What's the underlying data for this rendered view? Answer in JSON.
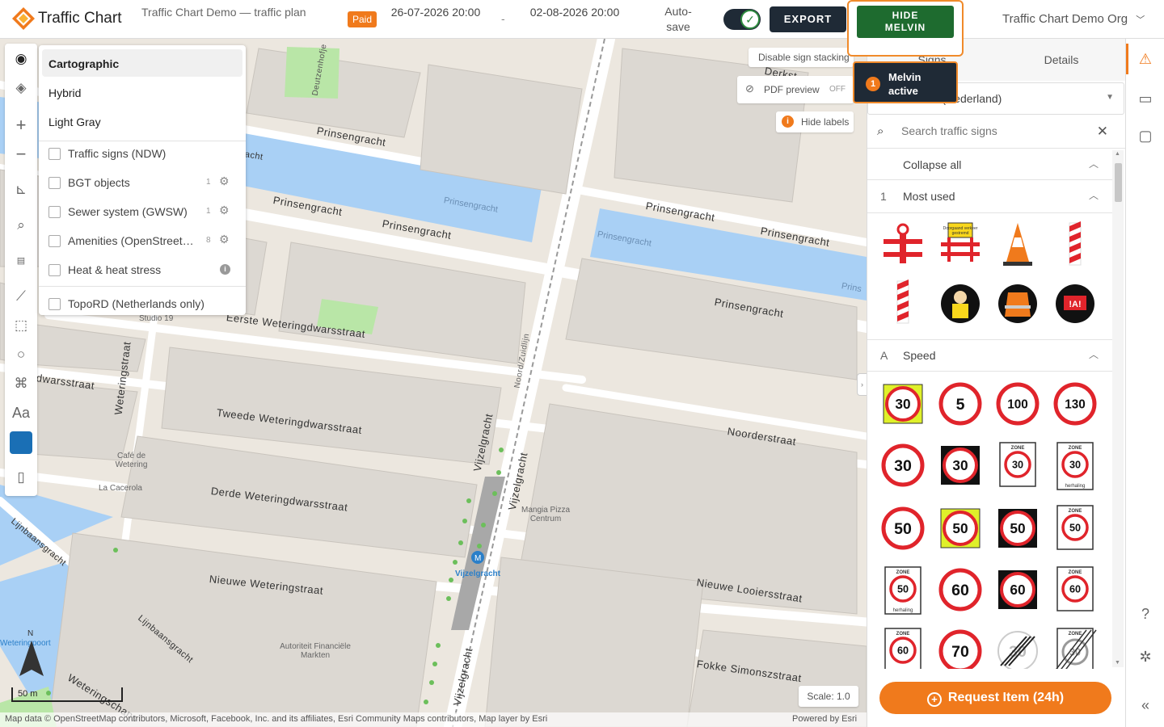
{
  "app": {
    "name": "Traffic Chart",
    "doc_title": "Traffic Chart Demo — traffic plan",
    "status_badge": "Paid"
  },
  "dates": {
    "start": "26-07-2026 20:00",
    "separator": "-",
    "end": "02-08-2026 20:00"
  },
  "autosave": {
    "label": "Auto-save",
    "on": true
  },
  "buttons": {
    "export": "EXPORT",
    "hide_melvin": "HIDE MELVIN",
    "request": "Request Item (24h)"
  },
  "org": {
    "name": "Traffic Chart Demo Org"
  },
  "colors": {
    "accent": "#f07a1c",
    "dark": "#1f2a36",
    "green": "#1e6b2f"
  },
  "basemaps": {
    "items": [
      "Cartographic",
      "Hybrid",
      "Light Gray"
    ],
    "selected": "Cartographic"
  },
  "layers": [
    {
      "label": "Traffic signs (NDW)",
      "count": "",
      "control": "none"
    },
    {
      "label": "BGT objects",
      "count": "1",
      "control": "gear"
    },
    {
      "label": "Sewer system (GWSW)",
      "count": "1",
      "control": "gear"
    },
    {
      "label": "Amenities (OpenStreet…",
      "count": "8",
      "control": "gear"
    },
    {
      "label": "Heat & heat stress",
      "count": "",
      "control": "info"
    },
    {
      "label": "TopoRD (Netherlands only)",
      "count": "",
      "control": "none"
    }
  ],
  "map_controls": {
    "disable_stacking": "Disable sign stacking",
    "pdf_preview": "PDF preview",
    "pdf_state": "OFF",
    "hide_labels": "Hide labels",
    "scale": "Scale: 1.0",
    "scalebar": "50 m",
    "north": "N"
  },
  "melvin": {
    "count": "1",
    "status": "Melvin active"
  },
  "map_labels": {
    "streets": [
      "Prinsengracht",
      "Prinsengracht",
      "Prinsengracht",
      "Prinsengracht",
      "Prinsengracht",
      "Prinsengracht",
      "Eerste Weteringdwarsstraat",
      "Tweede Weteringdwarsstraat",
      "Derde Weteringdwarsstraat",
      "Nieuwe Weteringstraat",
      "Weteringstraat",
      "Vijzelgracht",
      "Vijzelgracht",
      "Vijzelgracht",
      "Noorderstraat",
      "Nieuwe Looiersstraat",
      "Fokke Simonszstraat",
      "Lijnbaansgracht",
      "Lijnbaansgracht",
      "Noord/Zuidlijn",
      "Deutzenhofje",
      "Weteringschans",
      "dwarsstraat",
      "Derkst",
      "acht"
    ],
    "canals": [
      "Prinsengracht",
      "Prinsengracht",
      "Prins"
    ],
    "pois": [
      "Studio 19",
      "Café de Wetering",
      "La Cacerola",
      "Mangia Pizza Centrum",
      "Vijzelgracht",
      "Autoriteit Financiële Markten",
      "Weteringpoort"
    ]
  },
  "attribution": {
    "left": "Map data © OpenStreetMap contributors, Microsoft, Facebook, Inc. and its affiliates, Esri Community Maps contributors, Map layer by Esri",
    "right": "Powered by Esri"
  },
  "panel": {
    "tab_signs": "Signs",
    "tab_details": "Details",
    "country": "Netherlands (Nederland)",
    "search_placeholder": "Search traffic signs",
    "collapse_all": "Collapse all",
    "sections": [
      {
        "key": "1",
        "title": "Most used"
      },
      {
        "key": "A",
        "title": "Speed"
      }
    ]
  },
  "signs": {
    "most_used": [
      {
        "name": "barrier-lamp-sign"
      },
      {
        "name": "road-closed-board-sign",
        "text": "Doorgaand verkeer gestremd"
      },
      {
        "name": "traffic-cone-sign"
      },
      {
        "name": "red-white-beacon-sign"
      },
      {
        "name": "red-white-post-sign"
      },
      {
        "name": "traffic-controller-sign"
      },
      {
        "name": "safety-vest-sign"
      },
      {
        "name": "warning-barrier-sign",
        "text": "!A!"
      }
    ],
    "speed": [
      {
        "style": "a1-yellow",
        "text": "30",
        "zone": "",
        "sub": ""
      },
      {
        "style": "a1",
        "text": "5",
        "zone": "",
        "sub": ""
      },
      {
        "style": "a1",
        "text": "100",
        "zone": "",
        "sub": ""
      },
      {
        "style": "a1",
        "text": "130",
        "zone": "",
        "sub": ""
      },
      {
        "style": "a1",
        "text": "30",
        "zone": "",
        "sub": ""
      },
      {
        "style": "a1-black",
        "text": "30",
        "zone": "",
        "sub": ""
      },
      {
        "style": "zone",
        "text": "30",
        "zone": "ZONE",
        "sub": ""
      },
      {
        "style": "zone",
        "text": "30",
        "zone": "ZONE",
        "sub": "herhaling"
      },
      {
        "style": "a1",
        "text": "50",
        "zone": "",
        "sub": ""
      },
      {
        "style": "a1-yellow",
        "text": "50",
        "zone": "",
        "sub": ""
      },
      {
        "style": "a1-black",
        "text": "50",
        "zone": "",
        "sub": ""
      },
      {
        "style": "zone",
        "text": "50",
        "zone": "ZONE",
        "sub": ""
      },
      {
        "style": "zone",
        "text": "50",
        "zone": "ZONE",
        "sub": "herhaling"
      },
      {
        "style": "a1",
        "text": "60",
        "zone": "",
        "sub": ""
      },
      {
        "style": "a1-black",
        "text": "60",
        "zone": "",
        "sub": ""
      },
      {
        "style": "zone",
        "text": "60",
        "zone": "ZONE",
        "sub": ""
      },
      {
        "style": "zone",
        "text": "60",
        "zone": "ZONE",
        "sub": "herhaling"
      },
      {
        "style": "a1",
        "text": "70",
        "zone": "",
        "sub": ""
      },
      {
        "style": "end",
        "text": "30",
        "zone": "",
        "sub": ""
      },
      {
        "style": "zone-end",
        "text": "30",
        "zone": "ZONE",
        "sub": ""
      }
    ]
  }
}
